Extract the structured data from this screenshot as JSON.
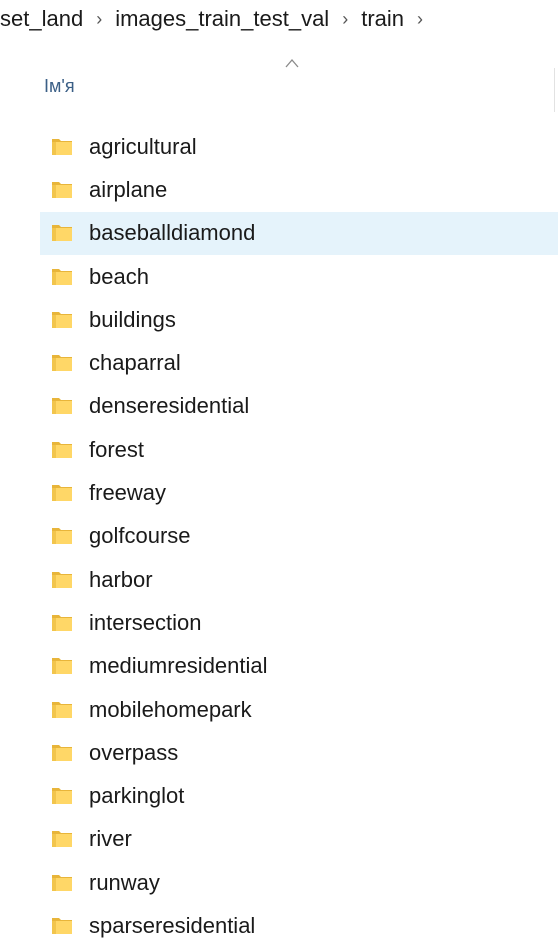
{
  "breadcrumb": {
    "items": [
      "set_land",
      "images_train_test_val",
      "train"
    ]
  },
  "column_header": {
    "name_label": "Ім'я"
  },
  "files": [
    {
      "name": "agricultural",
      "type": "folder"
    },
    {
      "name": "airplane",
      "type": "folder"
    },
    {
      "name": "baseballdiamond",
      "type": "folder",
      "selected": true
    },
    {
      "name": "beach",
      "type": "folder"
    },
    {
      "name": "buildings",
      "type": "folder"
    },
    {
      "name": "chaparral",
      "type": "folder"
    },
    {
      "name": "denseresidential",
      "type": "folder"
    },
    {
      "name": "forest",
      "type": "folder"
    },
    {
      "name": "freeway",
      "type": "folder"
    },
    {
      "name": "golfcourse",
      "type": "folder"
    },
    {
      "name": "harbor",
      "type": "folder"
    },
    {
      "name": "intersection",
      "type": "folder"
    },
    {
      "name": "mediumresidential",
      "type": "folder"
    },
    {
      "name": "mobilehomepark",
      "type": "folder"
    },
    {
      "name": "overpass",
      "type": "folder"
    },
    {
      "name": "parkinglot",
      "type": "folder"
    },
    {
      "name": "river",
      "type": "folder"
    },
    {
      "name": "runway",
      "type": "folder"
    },
    {
      "name": "sparseresidential",
      "type": "folder"
    }
  ],
  "icons": {
    "breadcrumb_separator": "chevron-right-icon",
    "sort_indicator": "sort-ascending-icon",
    "folder": "folder-icon"
  },
  "colors": {
    "selected_row": "#e5f3fb",
    "folder": "#ffd767",
    "header_text": "#3b5f86"
  }
}
